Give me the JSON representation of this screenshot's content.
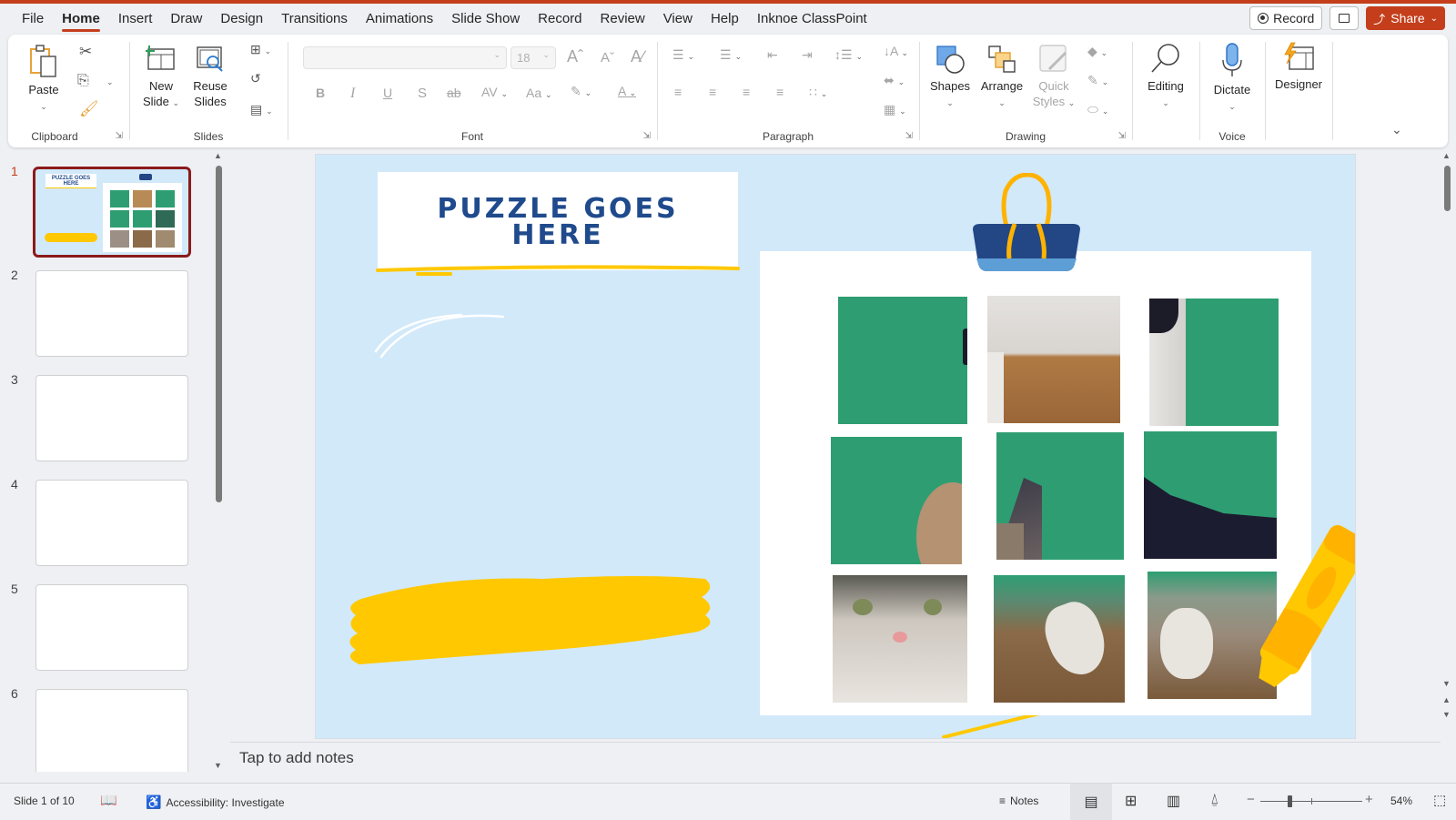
{
  "menu": {
    "tabs": [
      "File",
      "Home",
      "Insert",
      "Draw",
      "Design",
      "Transitions",
      "Animations",
      "Slide Show",
      "Record",
      "Review",
      "View",
      "Help",
      "Inknoe ClassPoint"
    ],
    "active_tab": "Home",
    "record_label": "Record",
    "share_label": "Share"
  },
  "ribbon": {
    "clipboard": {
      "label": "Clipboard",
      "paste": "Paste"
    },
    "slides": {
      "label": "Slides",
      "new_slide_1": "New",
      "new_slide_2": "Slide",
      "reuse_1": "Reuse",
      "reuse_2": "Slides"
    },
    "font": {
      "label": "Font",
      "font_name": "",
      "font_size": "18",
      "bold": "B",
      "italic": "I",
      "underline": "U",
      "shadow": "S",
      "strike": "ab",
      "spacing": "AV",
      "case": "Aa"
    },
    "paragraph": {
      "label": "Paragraph"
    },
    "drawing": {
      "label": "Drawing",
      "shapes": "Shapes",
      "arrange": "Arrange",
      "quick_styles_1": "Quick",
      "quick_styles_2": "Styles"
    },
    "editing": {
      "label": "Editing"
    },
    "voice": {
      "label": "Voice",
      "dictate": "Dictate"
    },
    "designer": {
      "label": "Designer"
    }
  },
  "thumbnails": {
    "numbers": [
      "1",
      "2",
      "3",
      "4",
      "5",
      "6"
    ],
    "active": 1
  },
  "slide": {
    "title_line1": "PUZZLE GOES",
    "title_line2": "HERE",
    "colors": {
      "background": "#d2e9fa",
      "title": "#1f4a8c",
      "accent_yellow": "#ffc800",
      "green": "#2e9e72",
      "clip_navy": "#234784"
    },
    "puzzle_pieces": 9
  },
  "notes": {
    "placeholder": "Tap to add notes"
  },
  "status": {
    "slide_info": "Slide 1 of 10",
    "accessibility": "Accessibility: Investigate",
    "notes_label": "Notes",
    "zoom_level": "54%",
    "zoom_fraction": 0.54
  }
}
